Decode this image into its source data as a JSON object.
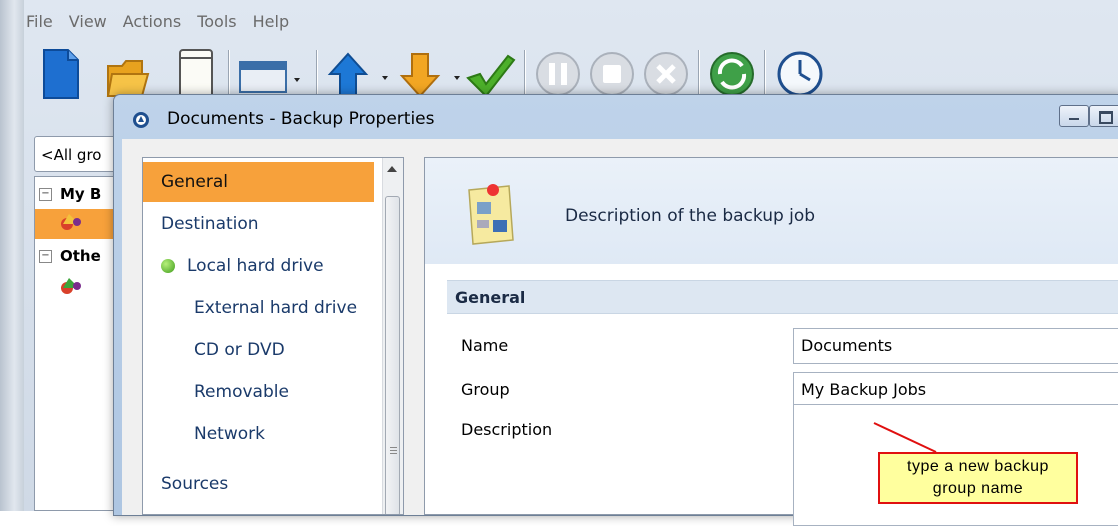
{
  "main_window": {
    "menu": [
      "File",
      "View",
      "Actions",
      "Tools",
      "Help"
    ],
    "group_combo_value": "<All gro",
    "tree": {
      "group1_label": "My B",
      "group2_label": "Othe"
    },
    "toolbar_icons": [
      "new-job-icon",
      "open-folder-icon",
      "properties-icon",
      "view-menu-icon",
      "upload-arrow-icon",
      "download-arrow-icon",
      "check-icon",
      "pause-icon",
      "stop-icon",
      "cancel-icon",
      "refresh-icon",
      "schedule-clock-icon"
    ]
  },
  "dialog": {
    "title": "Documents - Backup Properties",
    "nav": {
      "items": [
        {
          "label": "General",
          "selected": true
        },
        {
          "label": "Destination"
        },
        {
          "label": "Local hard drive"
        },
        {
          "label": "External hard drive"
        },
        {
          "label": "CD or DVD"
        },
        {
          "label": "Removable"
        },
        {
          "label": "Network"
        },
        {
          "label": "Sources"
        }
      ]
    },
    "header_description": "Description of the backup job",
    "section_title": "General",
    "fields": {
      "name_label": "Name",
      "name_value": "Documents",
      "group_label": "Group",
      "group_value": "My Backup Jobs",
      "description_label": "Description"
    }
  },
  "callout": {
    "line1": "type a new backup",
    "line2": "group name"
  },
  "colors": {
    "selected_nav": "#f7a13b",
    "callout_border": "#e01010",
    "callout_fill": "#ffff9e"
  }
}
